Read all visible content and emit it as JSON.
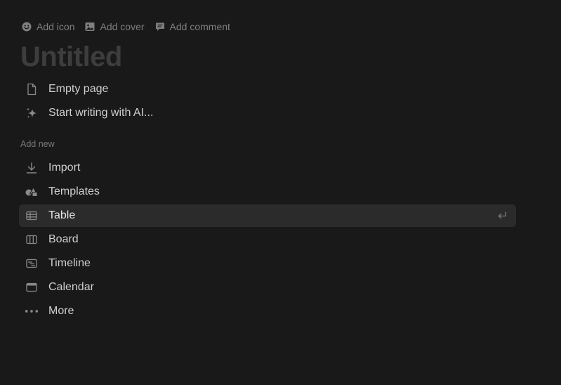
{
  "top_actions": {
    "add_icon": "Add icon",
    "add_cover": "Add cover",
    "add_comment": "Add comment"
  },
  "title": "Untitled",
  "suggestions": [
    {
      "icon": "page-icon",
      "label": "Empty page"
    },
    {
      "icon": "sparkle-icon",
      "label": "Start writing with AI..."
    }
  ],
  "add_new": {
    "heading": "Add new",
    "items": [
      {
        "icon": "import-icon",
        "label": "Import"
      },
      {
        "icon": "templates-icon",
        "label": "Templates"
      },
      {
        "icon": "table-icon",
        "label": "Table",
        "selected": true
      },
      {
        "icon": "board-icon",
        "label": "Board"
      },
      {
        "icon": "timeline-icon",
        "label": "Timeline"
      },
      {
        "icon": "calendar-icon",
        "label": "Calendar"
      },
      {
        "icon": "more-icon",
        "label": "More"
      }
    ]
  },
  "colors": {
    "background": "#191919",
    "selected_row": "#2b2b2b",
    "title": "#3d3d3d",
    "muted_text": "#7f7f7f"
  }
}
